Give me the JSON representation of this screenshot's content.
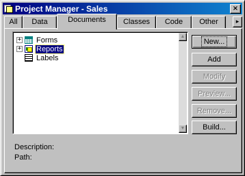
{
  "window": {
    "title": "Project Manager - Sales",
    "close_glyph": "×"
  },
  "tabs": [
    {
      "label": "All",
      "active": false
    },
    {
      "label": "Data",
      "active": false
    },
    {
      "label": "Documents",
      "active": true
    },
    {
      "label": "Classes",
      "active": false
    },
    {
      "label": "Code",
      "active": false
    },
    {
      "label": "Other",
      "active": false
    }
  ],
  "tab_scroll_glyph": "▸",
  "tree": {
    "items": [
      {
        "label": "Forms",
        "icon": "form-icon",
        "expandable": true,
        "selected": false
      },
      {
        "label": "Reports",
        "icon": "report-icon",
        "expandable": true,
        "selected": true
      },
      {
        "label": "Labels",
        "icon": "label-icon",
        "expandable": false,
        "selected": false
      }
    ],
    "expander_glyph": "+",
    "scroll_up_glyph": "▲",
    "scroll_down_glyph": "▼"
  },
  "buttons": {
    "new": "New...",
    "add": "Add",
    "modify": "Modify",
    "preview": "Preview...",
    "remove": "Remove...",
    "build": "Build..."
  },
  "button_states": {
    "new": "default",
    "add": "enabled",
    "modify": "disabled",
    "preview": "disabled",
    "remove": "disabled",
    "build": "enabled"
  },
  "info": {
    "description_label": "Description:",
    "description_value": "",
    "path_label": "Path:",
    "path_value": ""
  },
  "colors": {
    "face": "#c0c0c0",
    "titlebar_start": "#000080",
    "titlebar_end": "#1084d0",
    "selection": "#000080",
    "disabled_text": "#808080"
  }
}
